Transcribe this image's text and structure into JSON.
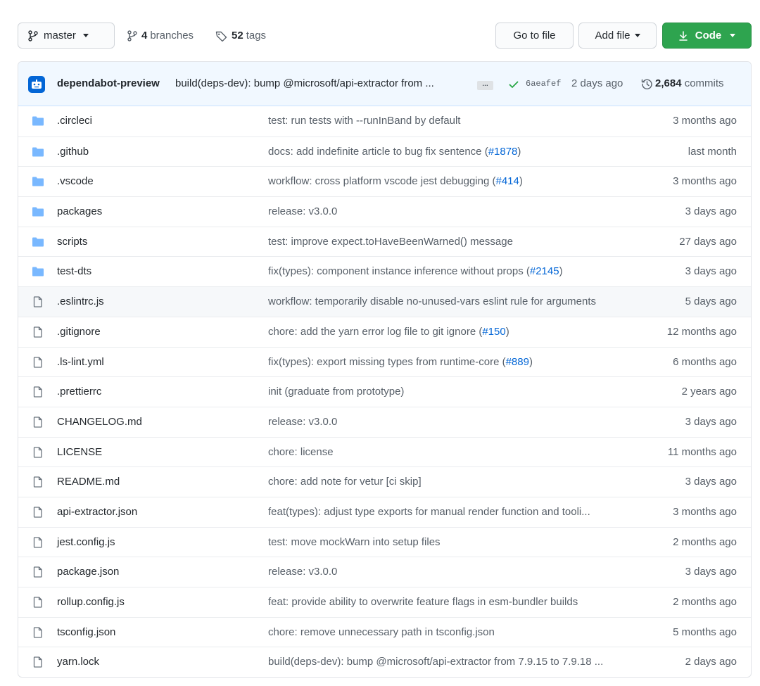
{
  "toolbar": {
    "branch_label": "master",
    "branches_count": "4",
    "branches_label": "branches",
    "tags_count": "52",
    "tags_label": "tags",
    "go_to_file_label": "Go to file",
    "add_file_label": "Add file",
    "code_label": "Code"
  },
  "latest_commit": {
    "author": "dependabot-preview",
    "message": "build(deps-dev): bump @microsoft/api-extractor from ...",
    "ellipsis": "…",
    "sha": "6aeafef",
    "time": "2 days ago",
    "commits_count": "2,684",
    "commits_label": "commits"
  },
  "colors": {
    "folder": "#79b8ff",
    "file": "#6a737d",
    "link": "#0366d6",
    "code_button": "#2ea44f",
    "check": "#28a745"
  },
  "files": [
    {
      "type": "folder",
      "name": ".circleci",
      "msg": "test: run tests with --runInBand by default",
      "pr": "",
      "msg_end": "",
      "age": "3 months ago"
    },
    {
      "type": "folder",
      "name": ".github",
      "msg": "docs: add indefinite article to bug fix sentence (",
      "pr": "#1878",
      "msg_end": ")",
      "age": "last month"
    },
    {
      "type": "folder",
      "name": ".vscode",
      "msg": "workflow: cross platform vscode jest debugging (",
      "pr": "#414",
      "msg_end": ")",
      "age": "3 months ago"
    },
    {
      "type": "folder",
      "name": "packages",
      "msg": "release: v3.0.0",
      "pr": "",
      "msg_end": "",
      "age": "3 days ago"
    },
    {
      "type": "folder",
      "name": "scripts",
      "msg": "test: improve expect.toHaveBeenWarned() message",
      "pr": "",
      "msg_end": "",
      "age": "27 days ago"
    },
    {
      "type": "folder",
      "name": "test-dts",
      "msg": "fix(types): component instance inference without props (",
      "pr": "#2145",
      "msg_end": ")",
      "age": "3 days ago"
    },
    {
      "type": "file",
      "name": ".eslintrc.js",
      "msg": "workflow: temporarily disable no-unused-vars eslint rule for arguments",
      "pr": "",
      "msg_end": "",
      "age": "5 days ago",
      "highlight": true
    },
    {
      "type": "file",
      "name": ".gitignore",
      "msg": "chore: add the yarn error log file to git ignore (",
      "pr": "#150",
      "msg_end": ")",
      "age": "12 months ago"
    },
    {
      "type": "file",
      "name": ".ls-lint.yml",
      "msg": "fix(types): export missing types from runtime-core (",
      "pr": "#889",
      "msg_end": ")",
      "age": "6 months ago"
    },
    {
      "type": "file",
      "name": ".prettierrc",
      "msg": "init (graduate from prototype)",
      "pr": "",
      "msg_end": "",
      "age": "2 years ago"
    },
    {
      "type": "file",
      "name": "CHANGELOG.md",
      "msg": "release: v3.0.0",
      "pr": "",
      "msg_end": "",
      "age": "3 days ago"
    },
    {
      "type": "file",
      "name": "LICENSE",
      "msg": "chore: license",
      "pr": "",
      "msg_end": "",
      "age": "11 months ago"
    },
    {
      "type": "file",
      "name": "README.md",
      "msg": "chore: add note for vetur [ci skip]",
      "pr": "",
      "msg_end": "",
      "age": "3 days ago"
    },
    {
      "type": "file",
      "name": "api-extractor.json",
      "msg": "feat(types): adjust type exports for manual render function and tooli...",
      "pr": "",
      "msg_end": "",
      "age": "3 months ago"
    },
    {
      "type": "file",
      "name": "jest.config.js",
      "msg": "test: move mockWarn into setup files",
      "pr": "",
      "msg_end": "",
      "age": "2 months ago"
    },
    {
      "type": "file",
      "name": "package.json",
      "msg": "release: v3.0.0",
      "pr": "",
      "msg_end": "",
      "age": "3 days ago"
    },
    {
      "type": "file",
      "name": "rollup.config.js",
      "msg": "feat: provide ability to overwrite feature flags in esm-bundler builds",
      "pr": "",
      "msg_end": "",
      "age": "2 months ago"
    },
    {
      "type": "file",
      "name": "tsconfig.json",
      "msg": "chore: remove unnecessary path in tsconfig.json",
      "pr": "",
      "msg_end": "",
      "age": "5 months ago"
    },
    {
      "type": "file",
      "name": "yarn.lock",
      "msg": "build(deps-dev): bump @microsoft/api-extractor from 7.9.15 to 7.9.18 ...",
      "pr": "",
      "msg_end": "",
      "age": "2 days ago"
    }
  ]
}
